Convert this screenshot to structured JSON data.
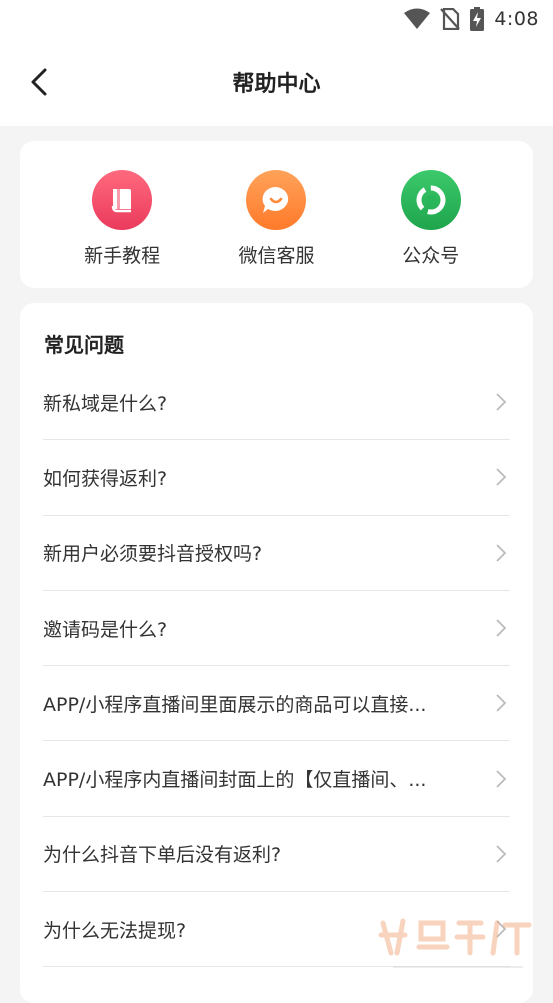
{
  "status_bar": {
    "time": "4:08",
    "icons": [
      "wifi-icon",
      "no-sim-icon",
      "battery-charging-icon"
    ]
  },
  "header": {
    "back_icon": "chevron-left-icon",
    "title": "帮助中心"
  },
  "quick_links": [
    {
      "label": "新手教程",
      "icon": "book-icon",
      "color": "#f2496a"
    },
    {
      "label": "微信客服",
      "icon": "chat-bubble-icon",
      "color": "#ff8a3d"
    },
    {
      "label": "公众号",
      "icon": "official-account-icon",
      "color": "#27b75a"
    }
  ],
  "faq": {
    "title": "常见问题",
    "items": [
      {
        "text": "新私域是什么?"
      },
      {
        "text": "如何获得返利?"
      },
      {
        "text": "新用户必须要抖音授权吗?"
      },
      {
        "text": "邀请码是什么?"
      },
      {
        "text": "APP/小程序直播间里面展示的商品可以直接..."
      },
      {
        "text": "APP/小程序内直播间封面上的【仅直播间、..."
      },
      {
        "text": "为什么抖音下单后没有返利?"
      },
      {
        "text": "为什么无法提现?"
      }
    ]
  },
  "colors": {
    "background": "#f4f4f4",
    "card": "#ffffff",
    "divider": "#e6e6e6",
    "chevron": "#bbbbbb"
  }
}
